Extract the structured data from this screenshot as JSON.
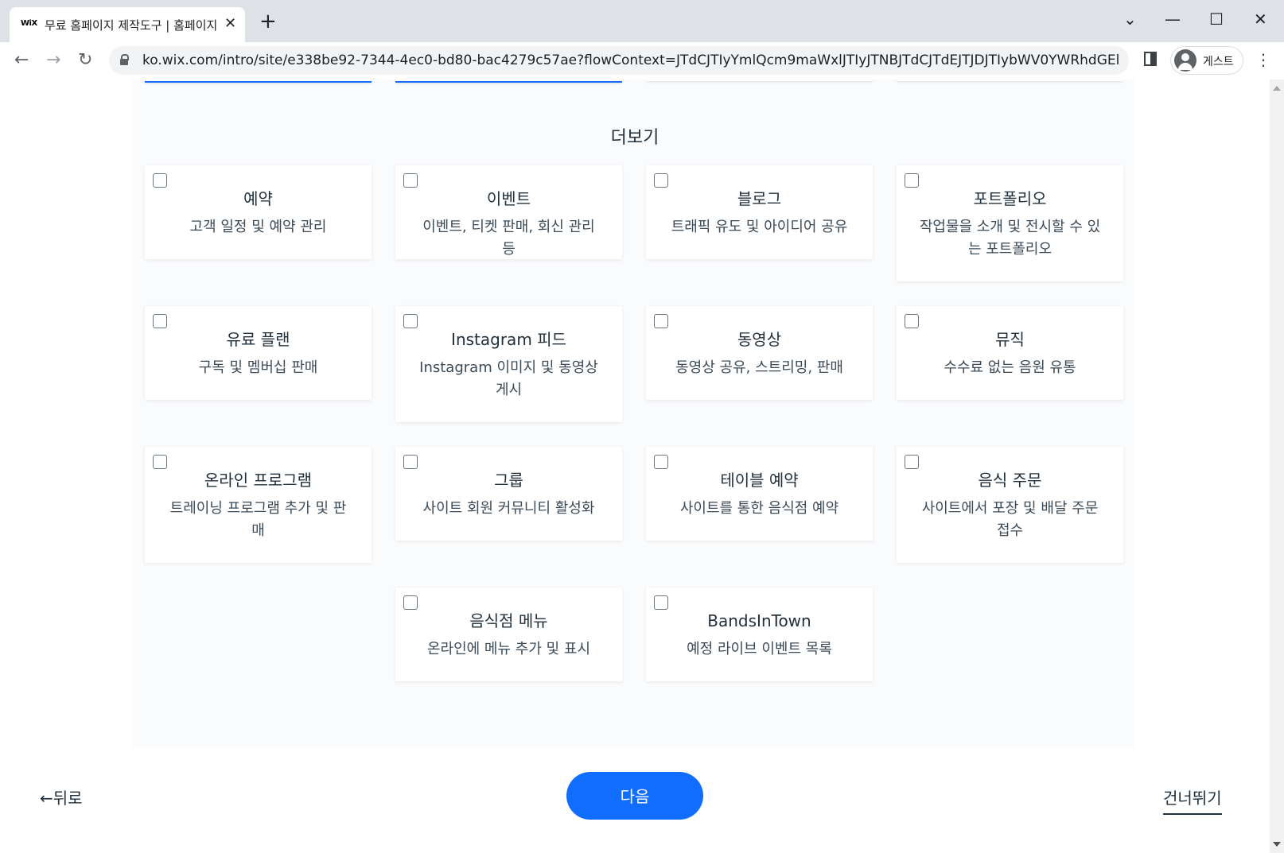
{
  "browser": {
    "tab_title": "무료 홈페이지 제작도구 | 홈페이지",
    "favicon_text": "WiX",
    "close_glyph": "✕",
    "new_tab_glyph": "+",
    "url": "ko.wix.com/intro/site/e338be92-7344-4ec0-bd80-bac4279c57ae?flowContext=JTdCJTIyYmlQcm9maWxlJTIyJTNBJTdCJTdEJTJDJTIybWV0YWRhdGElMjIlM0E...",
    "profile_label": "게스트",
    "icons": {
      "back": "←",
      "forward": "→",
      "reload": "↻",
      "minimize": "—",
      "maximize": "☐",
      "close": "✕",
      "dropdown": "⌄",
      "menu": "⋮"
    }
  },
  "page": {
    "section_title": "더보기",
    "cards": [
      {
        "title": "예약",
        "desc": "고객 일정 및 예약 관리"
      },
      {
        "title": "이벤트",
        "desc": "이벤트, 티켓 판매, 회신 관리 등"
      },
      {
        "title": "블로그",
        "desc": "트래픽 유도 및 아이디어 공유"
      },
      {
        "title": "포트폴리오",
        "desc": "작업물을 소개 및 전시할 수 있는 포트폴리오"
      },
      {
        "title": "유료 플랜",
        "desc": "구독 및 멤버십 판매"
      },
      {
        "title": "Instagram 피드",
        "desc": "Instagram 이미지 및 동영상 게시"
      },
      {
        "title": "동영상",
        "desc": "동영상 공유, 스트리밍, 판매"
      },
      {
        "title": "뮤직",
        "desc": "수수료 없는 음원 유통"
      },
      {
        "title": "온라인 프로그램",
        "desc": "트레이닝 프로그램 추가 및 판매"
      },
      {
        "title": "그룹",
        "desc": "사이트 회원 커뮤니티 활성화"
      },
      {
        "title": "테이블 예약",
        "desc": "사이트를 통한 음식점 예약"
      },
      {
        "title": "음식 주문",
        "desc": "사이트에서 포장 및 배달 주문 접수"
      },
      {
        "title": "음식점 메뉴",
        "desc": "온라인에 메뉴 추가 및 표시"
      },
      {
        "title": "BandsInTown",
        "desc": "예정 라이브 이벤트 목록"
      }
    ],
    "footer": {
      "back_label": "←뒤로",
      "next_label": "다음",
      "skip_label": "건너뛰기"
    },
    "colors": {
      "primary": "#116dff",
      "text": "#20303c"
    }
  }
}
